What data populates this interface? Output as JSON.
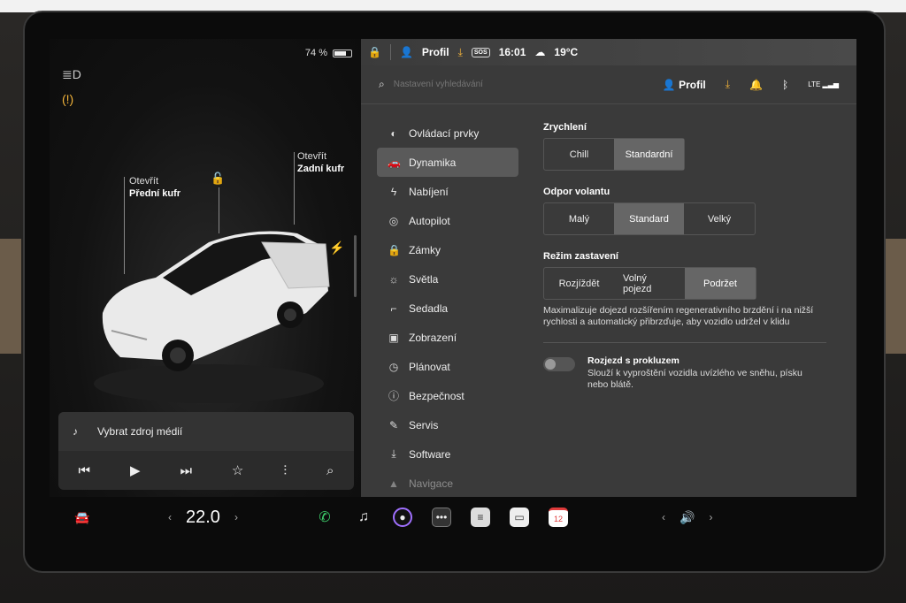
{
  "battery": {
    "percent_label": "74 %",
    "level": 0.74
  },
  "car": {
    "front_trunk": {
      "action": "Otevřít",
      "label": "Přední kufr"
    },
    "rear_trunk": {
      "action": "Otevřít",
      "label": "Zadní kufr"
    }
  },
  "media": {
    "source_label": "Vybrat zdroj médií"
  },
  "status_bar": {
    "profile": "Profil",
    "sos": "SOS",
    "time": "16:01",
    "temperature": "19°C"
  },
  "search": {
    "placeholder": "Nastavení vyhledávání",
    "profile": "Profil",
    "lte": "LTE"
  },
  "nav": {
    "items": [
      {
        "label": "Ovládací prvky",
        "icon": "toggle-icon"
      },
      {
        "label": "Dynamika",
        "icon": "car-icon"
      },
      {
        "label": "Nabíjení",
        "icon": "bolt-icon"
      },
      {
        "label": "Autopilot",
        "icon": "steering-wheel-icon"
      },
      {
        "label": "Zámky",
        "icon": "lock-icon"
      },
      {
        "label": "Světla",
        "icon": "sun-icon"
      },
      {
        "label": "Sedadla",
        "icon": "seat-icon"
      },
      {
        "label": "Zobrazení",
        "icon": "display-icon"
      },
      {
        "label": "Plánovat",
        "icon": "clock-icon"
      },
      {
        "label": "Bezpečnost",
        "icon": "alert-icon"
      },
      {
        "label": "Servis",
        "icon": "wrench-icon"
      },
      {
        "label": "Software",
        "icon": "download-icon"
      },
      {
        "label": "Navigace",
        "icon": "navigation-icon"
      }
    ],
    "active_index": 1
  },
  "dynamics": {
    "acceleration": {
      "title": "Zrychlení",
      "options": [
        "Chill",
        "Standardní"
      ],
      "selected": 1
    },
    "steering": {
      "title": "Odpor volantu",
      "options": [
        "Malý",
        "Standard",
        "Velký"
      ],
      "selected": 1
    },
    "stopping": {
      "title": "Režim zastavení",
      "options": [
        "Rozjíždět",
        "Volný pojezd",
        "Podržet"
      ],
      "selected": 2,
      "description": "Maximalizuje dojezd rozšířením regenerativního brzdění i na nižší rychlosti a automatický přibrzďuje, aby vozidlo udržel v klidu"
    },
    "slip_start": {
      "title": "Rozjezd s prokluzem",
      "description": "Slouží k vyproštění vozidla uvízlého ve sněhu, písku nebo blátě.",
      "enabled": false
    }
  },
  "dock": {
    "temperature": "22.0",
    "calendar_day": "12"
  },
  "colors": {
    "accent_yellow": "#f2b33a",
    "phone_green": "#3ecf6b",
    "calendar_red": "#e03b3b"
  }
}
